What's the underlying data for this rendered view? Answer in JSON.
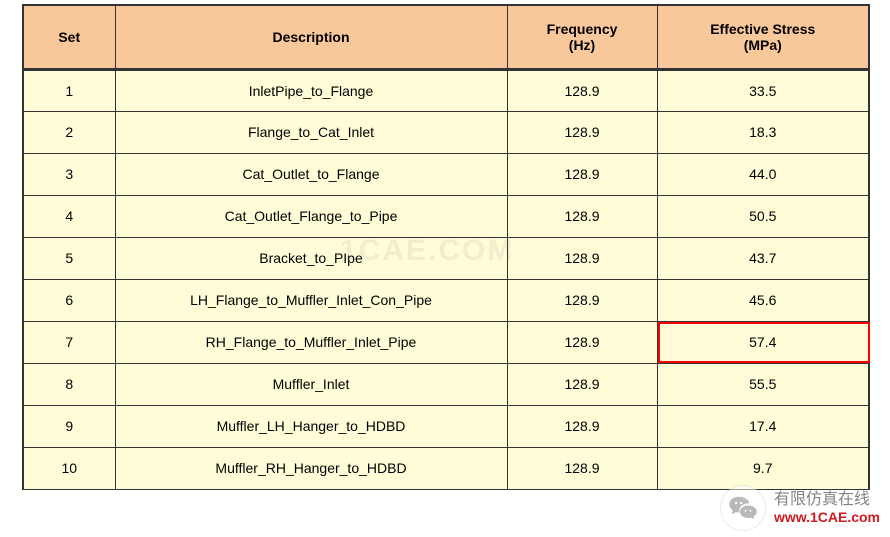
{
  "chart_data": {
    "type": "table",
    "columns": [
      "Set",
      "Description",
      "Frequency (Hz)",
      "Effective Stress (MPa)"
    ],
    "rows": [
      {
        "set": "1",
        "desc": "InletPipe_to_Flange",
        "freq": "128.9",
        "stress": "33.5",
        "highlight": false
      },
      {
        "set": "2",
        "desc": "Flange_to_Cat_Inlet",
        "freq": "128.9",
        "stress": "18.3",
        "highlight": false
      },
      {
        "set": "3",
        "desc": "Cat_Outlet_to_Flange",
        "freq": "128.9",
        "stress": "44.0",
        "highlight": false
      },
      {
        "set": "4",
        "desc": "Cat_Outlet_Flange_to_Pipe",
        "freq": "128.9",
        "stress": "50.5",
        "highlight": false
      },
      {
        "set": "5",
        "desc": "Bracket_to_PIpe",
        "freq": "128.9",
        "stress": "43.7",
        "highlight": false
      },
      {
        "set": "6",
        "desc": "LH_Flange_to_Muffler_Inlet_Con_Pipe",
        "freq": "128.9",
        "stress": "45.6",
        "highlight": false
      },
      {
        "set": "7",
        "desc": "RH_Flange_to_Muffler_Inlet_Pipe",
        "freq": "128.9",
        "stress": "57.4",
        "highlight": true
      },
      {
        "set": "8",
        "desc": "Muffler_Inlet",
        "freq": "128.9",
        "stress": "55.5",
        "highlight": false
      },
      {
        "set": "9",
        "desc": "Muffler_LH_Hanger_to_HDBD",
        "freq": "128.9",
        "stress": "17.4",
        "highlight": false
      },
      {
        "set": "10",
        "desc": "Muffler_RH_Hanger_to_HDBD",
        "freq": "128.9",
        "stress": "9.7",
        "highlight": false
      }
    ]
  },
  "headers": {
    "set": "Set",
    "desc": "Description",
    "freq_line1": "Frequency",
    "freq_line2": "(Hz)",
    "stress_line1": "Effective Stress",
    "stress_line2": "(MPa)"
  },
  "watermark": {
    "center": "1CAE.COM"
  },
  "footer": {
    "cn": "有限仿真在线",
    "url": "www.1CAE.com"
  }
}
